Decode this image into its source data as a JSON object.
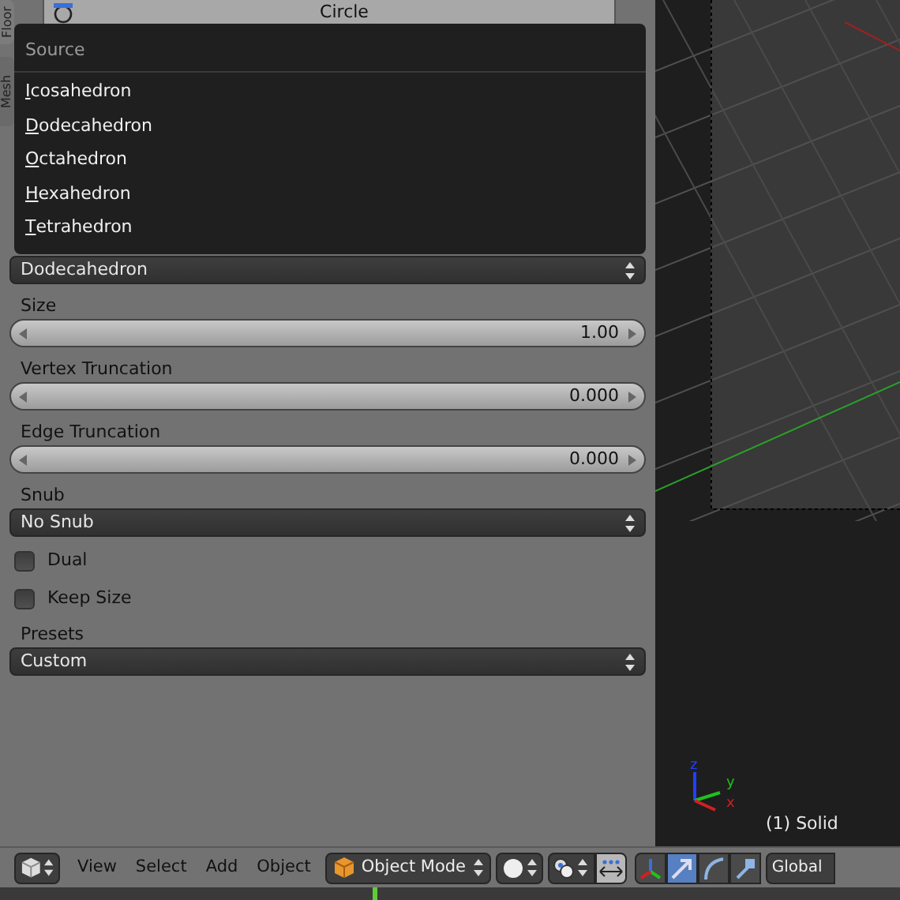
{
  "side_tabs": [
    {
      "label": "Floor"
    },
    {
      "label": "Mesh"
    }
  ],
  "object_list": [
    {
      "label": "Circle"
    }
  ],
  "properties": [
    {
      "kind": "dropdown",
      "value": "Dodecahedron"
    },
    {
      "kind": "slider",
      "label": "Size",
      "value": "1.00"
    },
    {
      "kind": "slider",
      "label": "Vertex Truncation",
      "value": "0.000"
    },
    {
      "kind": "slider",
      "label": "Edge Truncation",
      "value": "0.000"
    },
    {
      "kind": "dropdown",
      "label": "Snub",
      "value": "No Snub"
    },
    {
      "kind": "checkbox",
      "label": "Dual",
      "checked": false
    },
    {
      "kind": "checkbox",
      "label": "Keep Size",
      "checked": false
    },
    {
      "kind": "dropdown",
      "label": "Presets",
      "value": "Custom"
    }
  ],
  "source_menu": {
    "title": "Source",
    "items": [
      {
        "label": "Icosahedron"
      },
      {
        "label": "Dodecahedron"
      },
      {
        "label": "Octahedron"
      },
      {
        "label": "Hexahedron"
      },
      {
        "label": "Tetrahedron"
      }
    ]
  },
  "viewport": {
    "info": "(1) Solid",
    "axis_labels": {
      "x": "x",
      "y": "y",
      "z": "z"
    }
  },
  "header": {
    "menus": [
      "View",
      "Select",
      "Add",
      "Object"
    ],
    "mode": "Object Mode",
    "manipulator_toggle": {
      "on": true
    },
    "manipulators": [
      {
        "kind": "axes",
        "selected": false
      },
      {
        "kind": "translate",
        "selected": true
      },
      {
        "kind": "rotate",
        "selected": false
      },
      {
        "kind": "scale",
        "selected": false
      }
    ],
    "orientation": "Global"
  }
}
